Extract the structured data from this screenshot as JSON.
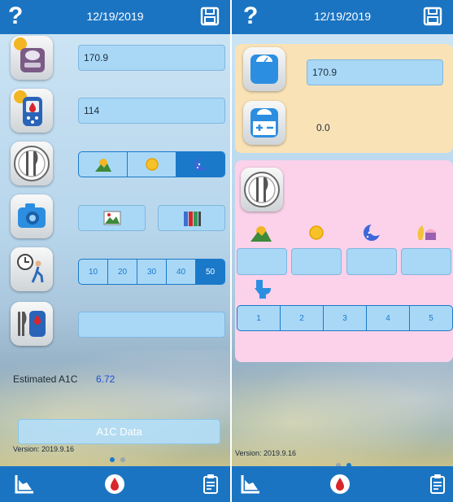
{
  "screens": [
    {
      "header": {
        "help_icon": "question-mark",
        "date": "12/19/2019",
        "save_icon": "floppy-disk-icon"
      },
      "weight": {
        "value": "170.9"
      },
      "glucose": {
        "value": "114"
      },
      "meal_time": {
        "options": [
          "sunrise-icon",
          "sun-icon",
          "moon-icon"
        ],
        "selected_index": 2
      },
      "camera": {
        "buttons": [
          "photo-icon",
          "books-icon"
        ]
      },
      "minutes_after": {
        "options": [
          "10",
          "20",
          "30",
          "40",
          "50"
        ],
        "selected": "50"
      },
      "notes": {
        "value": ""
      },
      "estimated_a1c": {
        "label": "Estimated A1C",
        "value": "6.72"
      },
      "a1c_button": {
        "label": "A1C Data"
      },
      "version": "Version: 2019.9.16",
      "page_indicator": {
        "count": 2,
        "current": 1
      },
      "tabbar": [
        "chart-icon",
        "blood-drop-icon",
        "clipboard-icon"
      ]
    },
    {
      "header": {
        "help_icon": "question-mark",
        "date": "12/19/2019",
        "save_icon": "floppy-disk-icon"
      },
      "weight": {
        "value": "170.9"
      },
      "weight_change": {
        "value": "0.0"
      },
      "meals": {
        "icons": [
          "sunrise-icon",
          "sun-icon",
          "moon-icon",
          "snack-icon"
        ],
        "values": [
          "",
          "",
          "",
          ""
        ]
      },
      "bathroom": {
        "icon": "toilet-icon",
        "options": [
          "1",
          "2",
          "3",
          "4",
          "5"
        ]
      },
      "version": "Version: 2019.9.16",
      "page_indicator": {
        "count": 2,
        "current": 2
      },
      "tabbar": [
        "chart-icon",
        "blood-drop-icon",
        "clipboard-icon"
      ]
    }
  ],
  "colors": {
    "header": "#1b74c2",
    "field": "#a9d8f7",
    "accent": "#1a79c9",
    "panel_yellow": "#f9e3b6",
    "panel_pink": "#fbd2ea",
    "a1c_value": "#1e4fd6"
  },
  "header": {
    "help_label": "?"
  }
}
